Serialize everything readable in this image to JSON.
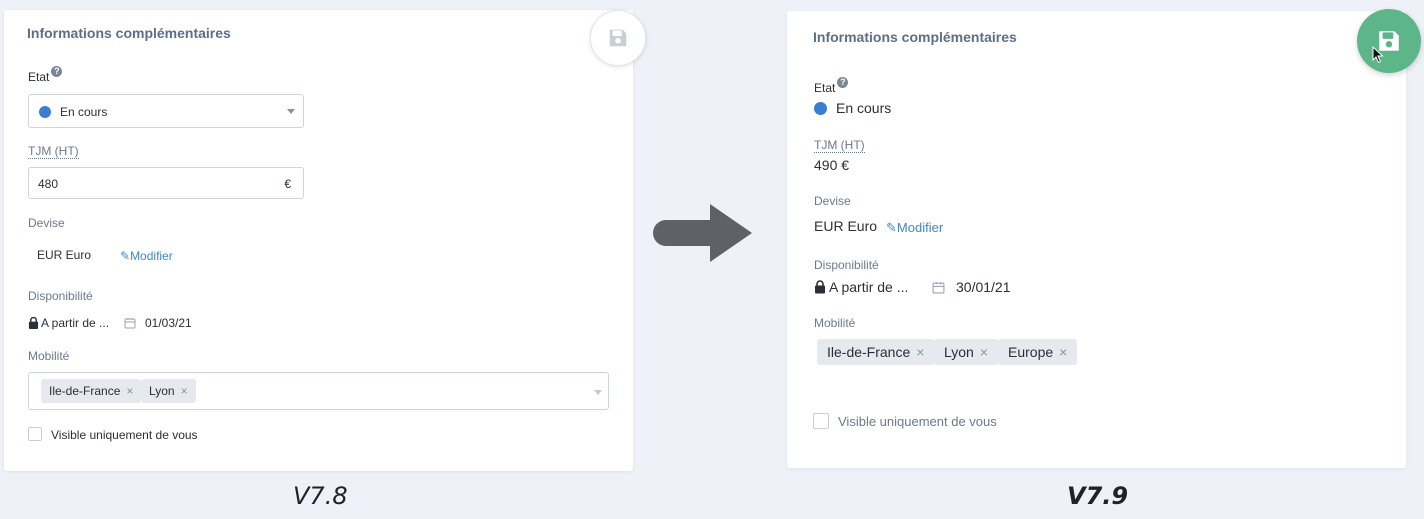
{
  "left": {
    "title": "Informations complémentaires",
    "etat": {
      "label": "Etat",
      "help": "?",
      "value": "En cours",
      "dot_color": "#3b7ed0"
    },
    "tjm": {
      "label": "TJM (HT)",
      "value": "480",
      "unit": "€"
    },
    "devise": {
      "label": "Devise",
      "value": "EUR Euro",
      "modifier": "Modifier"
    },
    "disponibilite": {
      "label": "Disponibilité",
      "value": "A partir de ...",
      "date": "01/03/21"
    },
    "mobilite": {
      "label": "Mobilité",
      "tags": [
        "Ile-de-France",
        "Lyon"
      ]
    },
    "visible": {
      "label": "Visible uniquement de vous"
    },
    "version": "V7.8"
  },
  "right": {
    "title": "Informations complémentaires",
    "etat": {
      "label": "Etat",
      "help": "?",
      "value": "En cours",
      "dot_color": "#3b7ed0"
    },
    "tjm": {
      "label": "TJM (HT)",
      "value": "490 €"
    },
    "devise": {
      "label": "Devise",
      "value": "EUR Euro",
      "modifier": "Modifier"
    },
    "disponibilite": {
      "label": "Disponibilité",
      "value": "A partir de ...",
      "date": "30/01/21"
    },
    "mobilite": {
      "label": "Mobilité",
      "tags": [
        "Ile-de-France",
        "Lyon",
        "Europe"
      ]
    },
    "visible": {
      "label": "Visible uniquement de vous"
    },
    "version": "V7.9"
  },
  "tag_remove_glyph": "×",
  "colors": {
    "accent": "#5db58a",
    "link": "#3f88c5",
    "status_dot": "#3b7ed0",
    "background": "#eef1f7"
  },
  "icons": [
    "save-icon",
    "help-icon",
    "pencil-icon",
    "lock-icon",
    "calendar-icon",
    "caret-down-icon",
    "arrow-right-icon",
    "cursor-icon"
  ]
}
